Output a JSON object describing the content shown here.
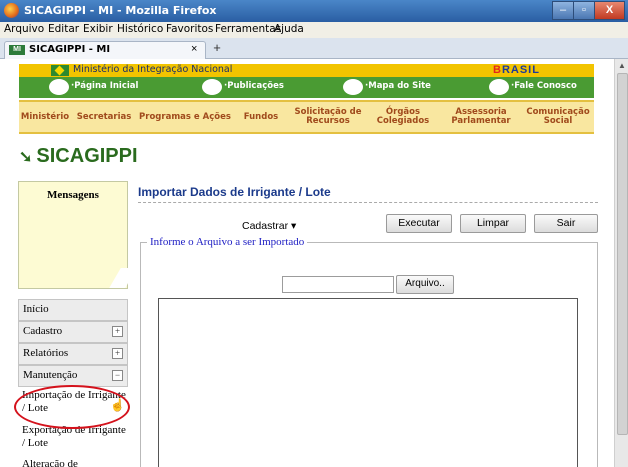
{
  "window": {
    "title": "SICAGIPPI - MI - Mozilla Firefox",
    "minimize": "–",
    "maximize": "▫",
    "close": "X"
  },
  "menubar": [
    "Arquivo",
    "Editar",
    "Exibir",
    "Histórico",
    "Favoritos",
    "Ferramentas",
    "Ajuda"
  ],
  "tab": {
    "label": "SICAGIPPI - MI",
    "close": "×",
    "new": "+"
  },
  "gov": {
    "ministry": "Ministério da Integração Nacional",
    "brand": "BRASIL",
    "links": [
      "·Página Inicial",
      "·Publicações",
      "·Mapa do Site",
      "·Fale Conosco"
    ]
  },
  "topmenu": [
    "Ministério",
    "Secretarias",
    "Programas e Ações",
    "Fundos",
    "Solicitação de Recursos",
    "Órgãos Colegiados",
    "Assessoria Parlamentar",
    "Comunicação Social"
  ],
  "logo": "SICAGIPPI",
  "sidebar": {
    "messages_title": "Mensagens",
    "items": [
      {
        "label": "Início",
        "expand": ""
      },
      {
        "label": "Cadastro",
        "expand": "+"
      },
      {
        "label": "Relatórios",
        "expand": "+"
      },
      {
        "label": "Manutenção",
        "expand": "−"
      }
    ],
    "subitems": [
      "Importação de Irrigante / Lote",
      "Exportação de Irrigante / Lote",
      "Alteração de"
    ]
  },
  "main": {
    "title": "Importar Dados de Irrigante / Lote",
    "dropdown": "Cadastrar",
    "buttons": [
      "Executar",
      "Limpar",
      "Sair"
    ],
    "fieldset_legend": "Informe o Arquivo a ser Importado",
    "file_button": "Arquivo..",
    "file_value": ""
  },
  "colors": {
    "gov_green": "#4a9b33",
    "gov_yellow": "#f2c400",
    "menu_text": "#a04a1c",
    "title_blue": "#1b3a8b",
    "highlight": "#d4121c"
  }
}
